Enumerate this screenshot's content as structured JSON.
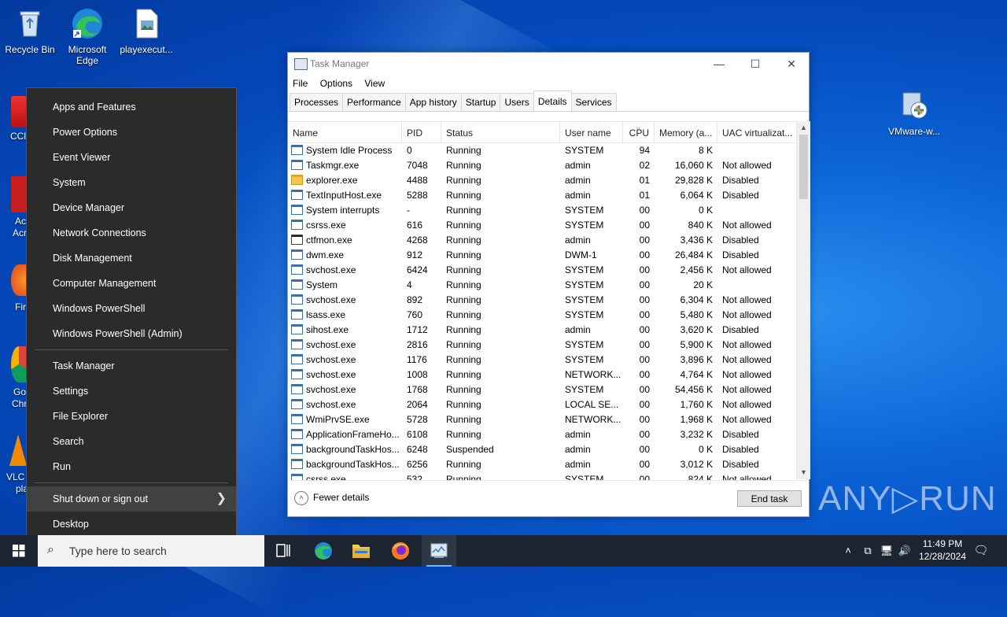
{
  "desktop": {
    "icons": [
      {
        "label": "Recycle Bin"
      },
      {
        "label": "Microsoft Edge"
      },
      {
        "label": "playexecut..."
      },
      {
        "label": "VMware-w..."
      }
    ],
    "partial_labels": [
      "CCl",
      "Ac",
      "Acr",
      "Fir",
      "Go",
      "Chr",
      "VLC",
      "pla"
    ]
  },
  "context_menu": {
    "group1": [
      "Apps and Features",
      "Power Options",
      "Event Viewer",
      "System",
      "Device Manager",
      "Network Connections",
      "Disk Management",
      "Computer Management",
      "Windows PowerShell",
      "Windows PowerShell (Admin)"
    ],
    "group2": [
      "Task Manager",
      "Settings",
      "File Explorer",
      "Search",
      "Run"
    ],
    "group3": [
      "Shut down or sign out",
      "Desktop"
    ]
  },
  "task_manager": {
    "title": "Task Manager",
    "window_buttons": {
      "minimize": "—",
      "maximize": "☐",
      "close": "✕"
    },
    "menu": [
      "File",
      "Options",
      "View"
    ],
    "tabs": [
      "Processes",
      "Performance",
      "App history",
      "Startup",
      "Users",
      "Details",
      "Services"
    ],
    "active_tab": "Details",
    "columns": [
      "Name",
      "PID",
      "Status",
      "User name",
      "CPU",
      "Memory (a...",
      "UAC virtualizat..."
    ],
    "rows": [
      {
        "name": "System Idle Process",
        "pid": "0",
        "status": "Running",
        "user": "SYSTEM",
        "cpu": "94",
        "mem": "8 K",
        "uac": "",
        "icon": "app"
      },
      {
        "name": "Taskmgr.exe",
        "pid": "7048",
        "status": "Running",
        "user": "admin",
        "cpu": "02",
        "mem": "16,060 K",
        "uac": "Not allowed",
        "icon": "app"
      },
      {
        "name": "explorer.exe",
        "pid": "4488",
        "status": "Running",
        "user": "admin",
        "cpu": "01",
        "mem": "29,828 K",
        "uac": "Disabled",
        "icon": "folder"
      },
      {
        "name": "TextInputHost.exe",
        "pid": "5288",
        "status": "Running",
        "user": "admin",
        "cpu": "01",
        "mem": "6,064 K",
        "uac": "Disabled",
        "icon": "app"
      },
      {
        "name": "System interrupts",
        "pid": "-",
        "status": "Running",
        "user": "SYSTEM",
        "cpu": "00",
        "mem": "0 K",
        "uac": "",
        "icon": "app"
      },
      {
        "name": "csrss.exe",
        "pid": "616",
        "status": "Running",
        "user": "SYSTEM",
        "cpu": "00",
        "mem": "840 K",
        "uac": "Not allowed",
        "icon": "app"
      },
      {
        "name": "ctfmon.exe",
        "pid": "4268",
        "status": "Running",
        "user": "admin",
        "cpu": "00",
        "mem": "3,436 K",
        "uac": "Disabled",
        "icon": "pen"
      },
      {
        "name": "dwm.exe",
        "pid": "912",
        "status": "Running",
        "user": "DWM-1",
        "cpu": "00",
        "mem": "26,484 K",
        "uac": "Disabled",
        "icon": "app"
      },
      {
        "name": "svchost.exe",
        "pid": "6424",
        "status": "Running",
        "user": "SYSTEM",
        "cpu": "00",
        "mem": "2,456 K",
        "uac": "Not allowed",
        "icon": "app"
      },
      {
        "name": "System",
        "pid": "4",
        "status": "Running",
        "user": "SYSTEM",
        "cpu": "00",
        "mem": "20 K",
        "uac": "",
        "icon": "app"
      },
      {
        "name": "svchost.exe",
        "pid": "892",
        "status": "Running",
        "user": "SYSTEM",
        "cpu": "00",
        "mem": "6,304 K",
        "uac": "Not allowed",
        "icon": "app"
      },
      {
        "name": "lsass.exe",
        "pid": "760",
        "status": "Running",
        "user": "SYSTEM",
        "cpu": "00",
        "mem": "5,480 K",
        "uac": "Not allowed",
        "icon": "app"
      },
      {
        "name": "sihost.exe",
        "pid": "1712",
        "status": "Running",
        "user": "admin",
        "cpu": "00",
        "mem": "3,620 K",
        "uac": "Disabled",
        "icon": "app"
      },
      {
        "name": "svchost.exe",
        "pid": "2816",
        "status": "Running",
        "user": "SYSTEM",
        "cpu": "00",
        "mem": "5,900 K",
        "uac": "Not allowed",
        "icon": "app"
      },
      {
        "name": "svchost.exe",
        "pid": "1176",
        "status": "Running",
        "user": "SYSTEM",
        "cpu": "00",
        "mem": "3,896 K",
        "uac": "Not allowed",
        "icon": "app"
      },
      {
        "name": "svchost.exe",
        "pid": "1008",
        "status": "Running",
        "user": "NETWORK...",
        "cpu": "00",
        "mem": "4,764 K",
        "uac": "Not allowed",
        "icon": "app"
      },
      {
        "name": "svchost.exe",
        "pid": "1768",
        "status": "Running",
        "user": "SYSTEM",
        "cpu": "00",
        "mem": "54,456 K",
        "uac": "Not allowed",
        "icon": "app"
      },
      {
        "name": "svchost.exe",
        "pid": "2064",
        "status": "Running",
        "user": "LOCAL SE...",
        "cpu": "00",
        "mem": "1,760 K",
        "uac": "Not allowed",
        "icon": "app"
      },
      {
        "name": "WmiPrvSE.exe",
        "pid": "5728",
        "status": "Running",
        "user": "NETWORK...",
        "cpu": "00",
        "mem": "1,968 K",
        "uac": "Not allowed",
        "icon": "app"
      },
      {
        "name": "ApplicationFrameHo...",
        "pid": "6108",
        "status": "Running",
        "user": "admin",
        "cpu": "00",
        "mem": "3,232 K",
        "uac": "Disabled",
        "icon": "app"
      },
      {
        "name": "backgroundTaskHos...",
        "pid": "6248",
        "status": "Suspended",
        "user": "admin",
        "cpu": "00",
        "mem": "0 K",
        "uac": "Disabled",
        "icon": "app"
      },
      {
        "name": "backgroundTaskHos...",
        "pid": "6256",
        "status": "Running",
        "user": "admin",
        "cpu": "00",
        "mem": "3,012 K",
        "uac": "Disabled",
        "icon": "app"
      },
      {
        "name": "csrss.exe",
        "pid": "532",
        "status": "Running",
        "user": "SYSTEM",
        "cpu": "00",
        "mem": "824 K",
        "uac": "Not allowed",
        "icon": "app"
      }
    ],
    "fewer_details": "Fewer details",
    "end_task": "End task"
  },
  "taskbar": {
    "search_placeholder": "Type here to search",
    "time": "11:49 PM",
    "date": "12/28/2024"
  },
  "watermark": "ANY▷RUN",
  "colors": {
    "accent": "#0078d7",
    "taskbar": "#1b2430",
    "menu_bg": "#2b2b2b"
  }
}
